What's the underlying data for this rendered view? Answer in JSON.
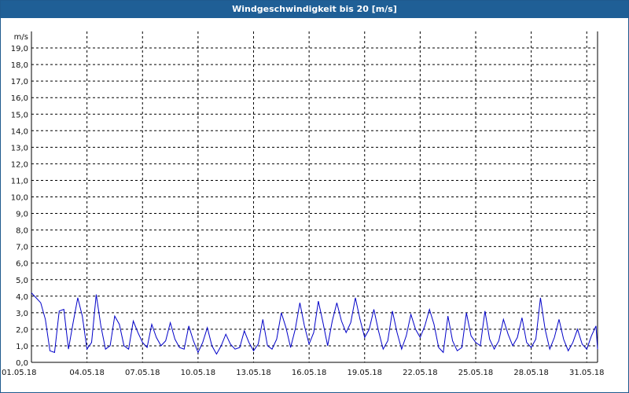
{
  "window": {
    "title": "Windgeschwindigkeit bis 20 [m/s]"
  },
  "colors": {
    "title_bar": "#1f5f96",
    "series": "#0000c8",
    "grid": "#000000"
  },
  "chart_data": {
    "type": "line",
    "title": "Windgeschwindigkeit bis 20 [m/s]",
    "ylabel": "m/s",
    "xlabel": "",
    "ylim": [
      0,
      20
    ],
    "xlim": [
      "01.05.18",
      "31.05.18 14:00"
    ],
    "grid": true,
    "grid_style": "dashed",
    "legend": "none",
    "y_ticks": [
      "0,0",
      "1,0",
      "2,0",
      "3,0",
      "4,0",
      "5,0",
      "6,0",
      "7,0",
      "8,0",
      "9,0",
      "10,0",
      "11,0",
      "12,0",
      "13,0",
      "14,0",
      "15,0",
      "16,0",
      "17,0",
      "18,0",
      "19,0"
    ],
    "x_ticks": [
      "01.05.18",
      "04.05.18",
      "07.05.18",
      "10.05.18",
      "13.05.18",
      "16.05.18",
      "19.05.18",
      "22.05.18",
      "25.05.18",
      "28.05.18",
      "31.05.18"
    ],
    "series": [
      {
        "name": "",
        "points": [
          [
            "01.05.18 00:00",
            4.2
          ],
          [
            "01.05.18 06:00",
            3.9
          ],
          [
            "01.05.18 12:00",
            3.6
          ],
          [
            "01.05.18 18:00",
            2.6
          ],
          [
            "02.05.18 00:00",
            0.7
          ],
          [
            "02.05.18 06:00",
            0.6
          ],
          [
            "02.05.18 12:00",
            3.1
          ],
          [
            "02.05.18 18:00",
            3.2
          ],
          [
            "03.05.18 00:00",
            0.8
          ],
          [
            "03.05.18 06:00",
            2.4
          ],
          [
            "03.05.18 12:00",
            3.9
          ],
          [
            "03.05.18 18:00",
            2.8
          ],
          [
            "04.05.18 00:00",
            0.8
          ],
          [
            "04.05.18 06:00",
            1.2
          ],
          [
            "04.05.18 12:00",
            4.1
          ],
          [
            "04.05.18 18:00",
            2.2
          ],
          [
            "05.05.18 00:00",
            0.8
          ],
          [
            "05.05.18 06:00",
            1.0
          ],
          [
            "05.05.18 12:00",
            2.8
          ],
          [
            "05.05.18 18:00",
            2.3
          ],
          [
            "06.05.18 00:00",
            1.0
          ],
          [
            "06.05.18 06:00",
            0.8
          ],
          [
            "06.05.18 12:00",
            2.5
          ],
          [
            "06.05.18 18:00",
            1.8
          ],
          [
            "07.05.18 00:00",
            1.2
          ],
          [
            "07.05.18 06:00",
            0.9
          ],
          [
            "07.05.18 12:00",
            2.3
          ],
          [
            "07.05.18 18:00",
            1.5
          ],
          [
            "08.05.18 00:00",
            1.0
          ],
          [
            "08.05.18 06:00",
            1.3
          ],
          [
            "08.05.18 12:00",
            2.4
          ],
          [
            "08.05.18 18:00",
            1.4
          ],
          [
            "09.05.18 00:00",
            0.9
          ],
          [
            "09.05.18 06:00",
            0.8
          ],
          [
            "09.05.18 12:00",
            2.2
          ],
          [
            "09.05.18 18:00",
            1.3
          ],
          [
            "10.05.18 00:00",
            0.6
          ],
          [
            "10.05.18 06:00",
            1.2
          ],
          [
            "10.05.18 12:00",
            2.1
          ],
          [
            "10.05.18 18:00",
            1.0
          ],
          [
            "11.05.18 00:00",
            0.5
          ],
          [
            "11.05.18 06:00",
            1.0
          ],
          [
            "11.05.18 12:00",
            1.7
          ],
          [
            "11.05.18 18:00",
            1.1
          ],
          [
            "12.05.18 00:00",
            0.8
          ],
          [
            "12.05.18 06:00",
            0.9
          ],
          [
            "12.05.18 12:00",
            1.9
          ],
          [
            "12.05.18 18:00",
            1.2
          ],
          [
            "13.05.18 00:00",
            0.7
          ],
          [
            "13.05.18 06:00",
            1.1
          ],
          [
            "13.05.18 12:00",
            2.6
          ],
          [
            "13.05.18 18:00",
            1.0
          ],
          [
            "14.05.18 00:00",
            0.8
          ],
          [
            "14.05.18 06:00",
            1.4
          ],
          [
            "14.05.18 12:00",
            3.0
          ],
          [
            "14.05.18 18:00",
            2.1
          ],
          [
            "15.05.18 00:00",
            0.9
          ],
          [
            "15.05.18 06:00",
            2.0
          ],
          [
            "15.05.18 12:00",
            3.6
          ],
          [
            "15.05.18 18:00",
            2.2
          ],
          [
            "16.05.18 00:00",
            1.1
          ],
          [
            "16.05.18 06:00",
            1.8
          ],
          [
            "16.05.18 12:00",
            3.7
          ],
          [
            "16.05.18 18:00",
            2.4
          ],
          [
            "17.05.18 00:00",
            1.0
          ],
          [
            "17.05.18 06:00",
            2.5
          ],
          [
            "17.05.18 12:00",
            3.6
          ],
          [
            "17.05.18 18:00",
            2.5
          ],
          [
            "18.05.18 00:00",
            1.8
          ],
          [
            "18.05.18 06:00",
            2.4
          ],
          [
            "18.05.18 12:00",
            3.9
          ],
          [
            "18.05.18 18:00",
            2.6
          ],
          [
            "19.05.18 00:00",
            1.5
          ],
          [
            "19.05.18 06:00",
            2.0
          ],
          [
            "19.05.18 12:00",
            3.2
          ],
          [
            "19.05.18 18:00",
            1.9
          ],
          [
            "20.05.18 00:00",
            0.8
          ],
          [
            "20.05.18 06:00",
            1.3
          ],
          [
            "20.05.18 12:00",
            3.1
          ],
          [
            "20.05.18 18:00",
            1.8
          ],
          [
            "21.05.18 00:00",
            0.8
          ],
          [
            "21.05.18 06:00",
            1.6
          ],
          [
            "21.05.18 12:00",
            2.9
          ],
          [
            "21.05.18 18:00",
            2.0
          ],
          [
            "22.05.18 00:00",
            1.5
          ],
          [
            "22.05.18 06:00",
            2.2
          ],
          [
            "22.05.18 12:00",
            3.2
          ],
          [
            "22.05.18 18:00",
            2.3
          ],
          [
            "23.05.18 00:00",
            0.9
          ],
          [
            "23.05.18 06:00",
            0.6
          ],
          [
            "23.05.18 12:00",
            2.8
          ],
          [
            "23.05.18 18:00",
            1.3
          ],
          [
            "24.05.18 00:00",
            0.7
          ],
          [
            "24.05.18 06:00",
            0.9
          ],
          [
            "24.05.18 12:00",
            3.0
          ],
          [
            "24.05.18 18:00",
            1.6
          ],
          [
            "25.05.18 00:00",
            1.2
          ],
          [
            "25.05.18 06:00",
            1.0
          ],
          [
            "25.05.18 12:00",
            3.1
          ],
          [
            "25.05.18 18:00",
            1.4
          ],
          [
            "26.05.18 00:00",
            0.8
          ],
          [
            "26.05.18 06:00",
            1.3
          ],
          [
            "26.05.18 12:00",
            2.6
          ],
          [
            "26.05.18 18:00",
            1.7
          ],
          [
            "27.05.18 00:00",
            1.0
          ],
          [
            "27.05.18 06:00",
            1.5
          ],
          [
            "27.05.18 12:00",
            2.7
          ],
          [
            "27.05.18 18:00",
            1.2
          ],
          [
            "28.05.18 00:00",
            0.9
          ],
          [
            "28.05.18 06:00",
            1.4
          ],
          [
            "28.05.18 12:00",
            3.9
          ],
          [
            "28.05.18 18:00",
            2.0
          ],
          [
            "29.05.18 00:00",
            0.8
          ],
          [
            "29.05.18 06:00",
            1.5
          ],
          [
            "29.05.18 12:00",
            2.6
          ],
          [
            "29.05.18 18:00",
            1.4
          ],
          [
            "30.05.18 00:00",
            0.7
          ],
          [
            "30.05.18 06:00",
            1.2
          ],
          [
            "30.05.18 12:00",
            2.0
          ],
          [
            "30.05.18 18:00",
            1.1
          ],
          [
            "31.05.18 00:00",
            0.8
          ],
          [
            "31.05.18 06:00",
            1.6
          ],
          [
            "31.05.18 12:00",
            2.2
          ],
          [
            "31.05.18 14:00",
            0.8
          ]
        ]
      }
    ]
  }
}
